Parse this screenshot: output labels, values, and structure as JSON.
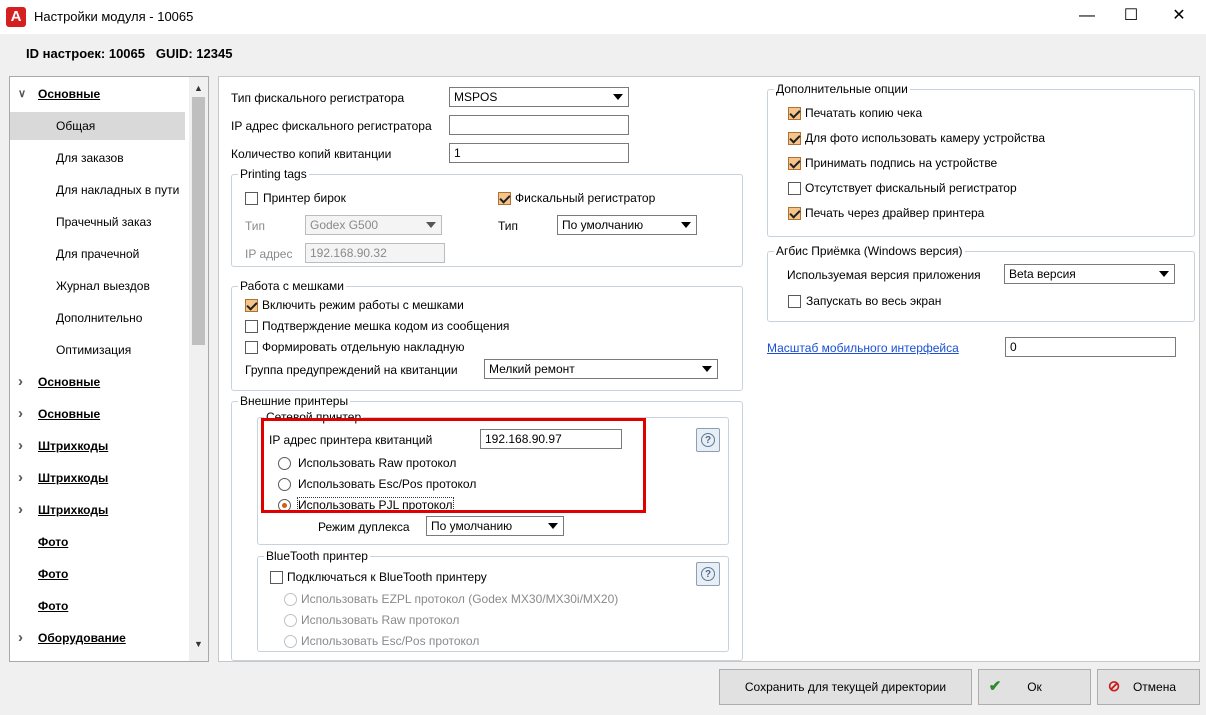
{
  "window": {
    "title": "Настройки модуля - 10065",
    "logo": "A",
    "controls": {
      "minimize": "—",
      "maximize": "☐",
      "close": "✕"
    }
  },
  "info": {
    "text": "ID настроек: 10065   GUID: 12345"
  },
  "nav": {
    "items": [
      {
        "label": "Основные",
        "bold": true,
        "arrow": "v"
      },
      {
        "label": "Общая",
        "selected": true
      },
      {
        "label": "Для заказов"
      },
      {
        "label": "Для накладных в пути"
      },
      {
        "label": "Прачечный заказ"
      },
      {
        "label": "Для прачечной"
      },
      {
        "label": "Журнал выездов"
      },
      {
        "label": "Дополнительно"
      },
      {
        "label": "Оптимизация"
      },
      {
        "label": "Основные",
        "bold": true,
        "arrow": ">"
      },
      {
        "label": "Основные",
        "bold": true,
        "arrow": ">"
      },
      {
        "label": "Штрихкоды",
        "bold": true,
        "arrow": ">"
      },
      {
        "label": "Штрихкоды",
        "bold": true,
        "arrow": ">"
      },
      {
        "label": "Штрихкоды",
        "bold": true,
        "arrow": ">"
      },
      {
        "label": "Фото",
        "bold": true
      },
      {
        "label": "Фото",
        "bold": true
      },
      {
        "label": "Фото",
        "bold": true
      },
      {
        "label": "Оборудование",
        "bold": true,
        "arrow": ">"
      }
    ]
  },
  "fiscal": {
    "type_label": "Тип фискального регистратора",
    "type_value": "MSPOS",
    "ip_label": "IP адрес фискального регистратора",
    "ip_value": "",
    "copies_label": "Количество копий квитанции",
    "copies_value": "1"
  },
  "printing_tags": {
    "title": "Printing tags",
    "tag_printer_label": "Принтер бирок",
    "tag_printer_checked": false,
    "type_label": "Тип",
    "type_value": "Godex G500",
    "ip_label": "IP адрес",
    "ip_value": "192.168.90.32",
    "fiscal_label": "Фискальный регистратор",
    "fiscal_checked": true,
    "fiscal_type_label": "Тип",
    "fiscal_type_value": "По умолчанию"
  },
  "bags": {
    "title": "Работа с мешками",
    "enable_label": "Включить режим работы с мешками",
    "confirm_label": "Подтверждение мешка кодом из сообщения",
    "separate_label": "Формировать отдельную накладную",
    "warning_group_label": "Группа предупреждений на квитанции",
    "warning_group_value": "Мелкий ремонт"
  },
  "external": {
    "title": "Внешние принтеры",
    "network": {
      "title": "Сетевой принтер",
      "ip_label": "IP адрес принтера квитанций",
      "ip_value": "192.168.90.97",
      "raw_label": "Использовать Raw протокол",
      "escpos_label": "Использовать Esc/Pos протокол",
      "pjl_label": "Использовать PJL протокол",
      "duplex_label": "Режим дуплекса",
      "duplex_value": "По умолчанию",
      "help": "?"
    },
    "bluetooth": {
      "title": "BlueTooth принтер",
      "connect_label": "Подключаться к BlueTooth принтеру",
      "ezpl_label": "Использовать EZPL протокол (Godex MX30/MX30i/MX20)",
      "raw_label": "Использовать Raw протокол",
      "escpos_label": "Использовать Esc/Pos протокол",
      "help": "?"
    }
  },
  "additional": {
    "title": "Дополнительные опции",
    "options": [
      {
        "label": "Печатать копию чека",
        "checked": true
      },
      {
        "label": "Для фото использовать камеру устройства",
        "checked": true
      },
      {
        "label": "Принимать подпись на устройстве",
        "checked": true
      },
      {
        "label": "Отсутствует фискальный регистратор",
        "checked": false
      },
      {
        "label": "Печать через драйвер принтера",
        "checked": true
      }
    ]
  },
  "agbis": {
    "title": "Агбис Приёмка (Windows версия)",
    "version_label": "Используемая версия приложения",
    "version_value": "Beta версия",
    "fullscreen_label": "Запускать во весь экран"
  },
  "scale": {
    "label": "Масштаб мобильного интерфейса",
    "value": "0"
  },
  "buttons": {
    "save": "Сохранить для текущей директории",
    "ok": "Ок",
    "cancel": "Отмена"
  },
  "colors": {
    "highlight": "#e00000",
    "accent_check": "#f5c48a",
    "link": "#1a4fd6"
  }
}
